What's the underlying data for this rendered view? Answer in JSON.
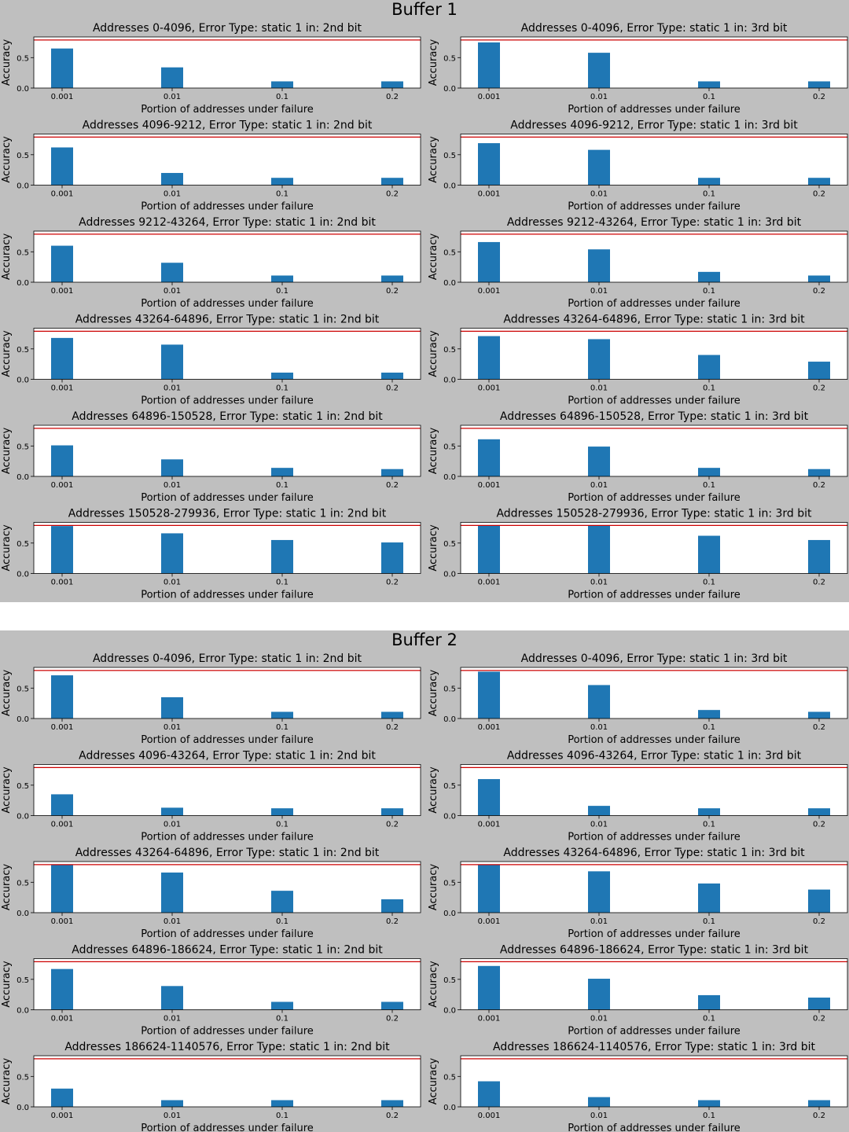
{
  "chart_data": [
    {
      "buffer": "Buffer 1",
      "charts": [
        {
          "type": "bar",
          "title": "Addresses 0-4096, Error Type: static 1 in: 2nd bit",
          "categories": [
            "0.001",
            "0.01",
            "0.1",
            "0.2"
          ],
          "values": [
            0.65,
            0.34,
            0.11,
            0.11
          ],
          "reference": 0.79
        },
        {
          "type": "bar",
          "title": "Addresses 0-4096, Error Type: static 1 in: 3rd bit",
          "categories": [
            "0.001",
            "0.01",
            "0.1",
            "0.2"
          ],
          "values": [
            0.75,
            0.58,
            0.11,
            0.11
          ],
          "reference": 0.79
        },
        {
          "type": "bar",
          "title": "Addresses 4096-9212, Error Type: static 1 in: 2nd bit",
          "categories": [
            "0.001",
            "0.01",
            "0.1",
            "0.2"
          ],
          "values": [
            0.62,
            0.2,
            0.12,
            0.12
          ],
          "reference": 0.79
        },
        {
          "type": "bar",
          "title": "Addresses 4096-9212, Error Type: static 1 in: 3rd bit",
          "categories": [
            "0.001",
            "0.01",
            "0.1",
            "0.2"
          ],
          "values": [
            0.69,
            0.58,
            0.12,
            0.12
          ],
          "reference": 0.79
        },
        {
          "type": "bar",
          "title": "Addresses 9212-43264, Error Type: static 1 in: 2nd bit",
          "categories": [
            "0.001",
            "0.01",
            "0.1",
            "0.2"
          ],
          "values": [
            0.6,
            0.32,
            0.11,
            0.11
          ],
          "reference": 0.79
        },
        {
          "type": "bar",
          "title": "Addresses 9212-43264, Error Type: static 1 in: 3rd bit",
          "categories": [
            "0.001",
            "0.01",
            "0.1",
            "0.2"
          ],
          "values": [
            0.66,
            0.54,
            0.17,
            0.11
          ],
          "reference": 0.79
        },
        {
          "type": "bar",
          "title": "Addresses 43264-64896, Error Type: static 1 in: 2nd bit",
          "categories": [
            "0.001",
            "0.01",
            "0.1",
            "0.2"
          ],
          "values": [
            0.68,
            0.57,
            0.11,
            0.11
          ],
          "reference": 0.79
        },
        {
          "type": "bar",
          "title": "Addresses 43264-64896, Error Type: static 1 in: 3rd bit",
          "categories": [
            "0.001",
            "0.01",
            "0.1",
            "0.2"
          ],
          "values": [
            0.71,
            0.66,
            0.4,
            0.29
          ],
          "reference": 0.79
        },
        {
          "type": "bar",
          "title": "Addresses 64896-150528, Error Type: static 1 in: 2nd bit",
          "categories": [
            "0.001",
            "0.01",
            "0.1",
            "0.2"
          ],
          "values": [
            0.51,
            0.28,
            0.14,
            0.12
          ],
          "reference": 0.79
        },
        {
          "type": "bar",
          "title": "Addresses 64896-150528, Error Type: static 1 in: 3rd bit",
          "categories": [
            "0.001",
            "0.01",
            "0.1",
            "0.2"
          ],
          "values": [
            0.61,
            0.49,
            0.14,
            0.12
          ],
          "reference": 0.79
        },
        {
          "type": "bar",
          "title": "Addresses 150528-279936, Error Type: static 1 in: 2nd bit",
          "categories": [
            "0.001",
            "0.01",
            "0.1",
            "0.2"
          ],
          "values": [
            0.78,
            0.66,
            0.55,
            0.51
          ],
          "reference": 0.79
        },
        {
          "type": "bar",
          "title": "Addresses 150528-279936, Error Type: static 1 in: 3rd bit",
          "categories": [
            "0.001",
            "0.01",
            "0.1",
            "0.2"
          ],
          "values": [
            0.79,
            0.79,
            0.62,
            0.55
          ],
          "reference": 0.79
        }
      ]
    },
    {
      "buffer": "Buffer 2",
      "charts": [
        {
          "type": "bar",
          "title": "Addresses 0-4096, Error Type: static 1 in: 2nd bit",
          "categories": [
            "0.001",
            "0.01",
            "0.1",
            "0.2"
          ],
          "values": [
            0.71,
            0.35,
            0.11,
            0.11
          ],
          "reference": 0.79
        },
        {
          "type": "bar",
          "title": "Addresses 0-4096, Error Type: static 1 in: 3rd bit",
          "categories": [
            "0.001",
            "0.01",
            "0.1",
            "0.2"
          ],
          "values": [
            0.77,
            0.55,
            0.14,
            0.11
          ],
          "reference": 0.79
        },
        {
          "type": "bar",
          "title": "Addresses 4096-43264, Error Type: static 1 in: 2nd bit",
          "categories": [
            "0.001",
            "0.01",
            "0.1",
            "0.2"
          ],
          "values": [
            0.35,
            0.13,
            0.12,
            0.12
          ],
          "reference": 0.79
        },
        {
          "type": "bar",
          "title": "Addresses 4096-43264, Error Type: static 1 in: 3rd bit",
          "categories": [
            "0.001",
            "0.01",
            "0.1",
            "0.2"
          ],
          "values": [
            0.6,
            0.16,
            0.12,
            0.12
          ],
          "reference": 0.79
        },
        {
          "type": "bar",
          "title": "Addresses 43264-64896, Error Type: static 1 in: 2nd bit",
          "categories": [
            "0.001",
            "0.01",
            "0.1",
            "0.2"
          ],
          "values": [
            0.79,
            0.66,
            0.36,
            0.22
          ],
          "reference": 0.79
        },
        {
          "type": "bar",
          "title": "Addresses 43264-64896, Error Type: static 1 in: 3rd bit",
          "categories": [
            "0.001",
            "0.01",
            "0.1",
            "0.2"
          ],
          "values": [
            0.79,
            0.68,
            0.48,
            0.38
          ],
          "reference": 0.79
        },
        {
          "type": "bar",
          "title": "Addresses 64896-186624, Error Type: static 1 in: 2nd bit",
          "categories": [
            "0.001",
            "0.01",
            "0.1",
            "0.2"
          ],
          "values": [
            0.67,
            0.39,
            0.13,
            0.13
          ],
          "reference": 0.79
        },
        {
          "type": "bar",
          "title": "Addresses 64896-186624, Error Type: static 1 in: 3rd bit",
          "categories": [
            "0.001",
            "0.01",
            "0.1",
            "0.2"
          ],
          "values": [
            0.72,
            0.51,
            0.24,
            0.2
          ],
          "reference": 0.79
        },
        {
          "type": "bar",
          "title": "Addresses 186624-1140576, Error Type: static 1 in: 2nd bit",
          "categories": [
            "0.001",
            "0.01",
            "0.1",
            "0.2"
          ],
          "values": [
            0.3,
            0.11,
            0.11,
            0.11
          ],
          "reference": 0.79
        },
        {
          "type": "bar",
          "title": "Addresses 186624-1140576, Error Type: static 1 in: 3rd bit",
          "categories": [
            "0.001",
            "0.01",
            "0.1",
            "0.2"
          ],
          "values": [
            0.42,
            0.16,
            0.11,
            0.11
          ],
          "reference": 0.79
        }
      ]
    }
  ],
  "axis": {
    "xlabel": "Portion of addresses under failure",
    "ylabel": "Accuracy",
    "yticks": [
      "0.0",
      "0.5"
    ],
    "ylim": [
      0,
      0.84
    ]
  },
  "colors": {
    "bar": "#1f77b4",
    "reference_line": "#cc0000",
    "figure_bg": "#bfbfbf",
    "axes_bg": "#ffffff"
  }
}
